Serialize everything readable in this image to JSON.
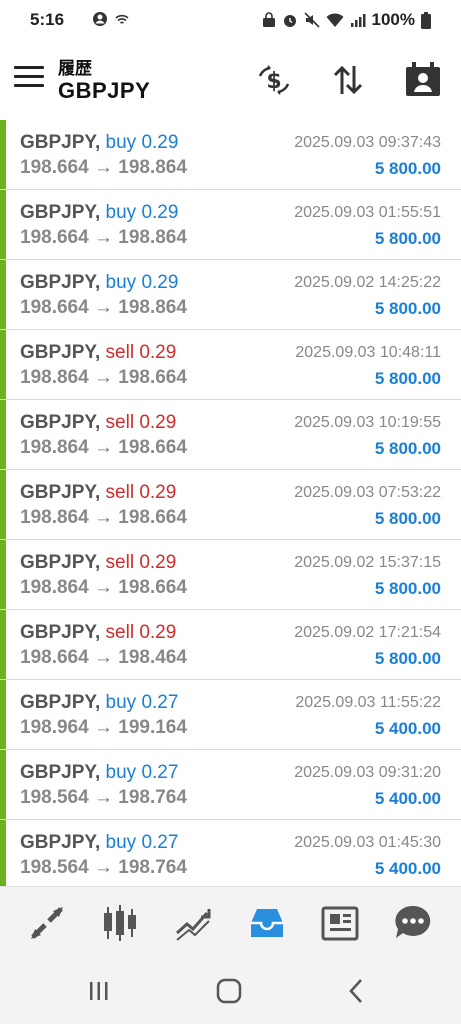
{
  "status": {
    "time": "5:16",
    "battery": "100%"
  },
  "header": {
    "subtitle": "履歴",
    "title": "GBPJPY"
  },
  "trades": [
    {
      "symbol": "GBPJPY,",
      "side": "buy",
      "side_label": "buy 0.29",
      "open": "198.664",
      "close": "198.864",
      "arrow": "→",
      "date": "2025.09.03 09:37:43",
      "profit": "5 800.00"
    },
    {
      "symbol": "GBPJPY,",
      "side": "buy",
      "side_label": "buy 0.29",
      "open": "198.664",
      "close": "198.864",
      "arrow": "→",
      "date": "2025.09.03 01:55:51",
      "profit": "5 800.00"
    },
    {
      "symbol": "GBPJPY,",
      "side": "buy",
      "side_label": "buy 0.29",
      "open": "198.664",
      "close": "198.864",
      "arrow": "→",
      "date": "2025.09.02 14:25:22",
      "profit": "5 800.00"
    },
    {
      "symbol": "GBPJPY,",
      "side": "sell",
      "side_label": "sell 0.29",
      "open": "198.864",
      "close": "198.664",
      "arrow": "→",
      "date": "2025.09.03 10:48:11",
      "profit": "5 800.00"
    },
    {
      "symbol": "GBPJPY,",
      "side": "sell",
      "side_label": "sell 0.29",
      "open": "198.864",
      "close": "198.664",
      "arrow": "→",
      "date": "2025.09.03 10:19:55",
      "profit": "5 800.00"
    },
    {
      "symbol": "GBPJPY,",
      "side": "sell",
      "side_label": "sell 0.29",
      "open": "198.864",
      "close": "198.664",
      "arrow": "→",
      "date": "2025.09.03 07:53:22",
      "profit": "5 800.00"
    },
    {
      "symbol": "GBPJPY,",
      "side": "sell",
      "side_label": "sell 0.29",
      "open": "198.864",
      "close": "198.664",
      "arrow": "→",
      "date": "2025.09.02 15:37:15",
      "profit": "5 800.00"
    },
    {
      "symbol": "GBPJPY,",
      "side": "sell",
      "side_label": "sell 0.29",
      "open": "198.664",
      "close": "198.464",
      "arrow": "→",
      "date": "2025.09.02 17:21:54",
      "profit": "5 800.00"
    },
    {
      "symbol": "GBPJPY,",
      "side": "buy",
      "side_label": "buy 0.27",
      "open": "198.964",
      "close": "199.164",
      "arrow": "→",
      "date": "2025.09.03 11:55:22",
      "profit": "5 400.00"
    },
    {
      "symbol": "GBPJPY,",
      "side": "buy",
      "side_label": "buy 0.27",
      "open": "198.564",
      "close": "198.764",
      "arrow": "→",
      "date": "2025.09.03 09:31:20",
      "profit": "5 400.00"
    },
    {
      "symbol": "GBPJPY,",
      "side": "buy",
      "side_label": "buy 0.27",
      "open": "198.564",
      "close": "198.764",
      "arrow": "→",
      "date": "2025.09.03 01:45:30",
      "profit": "5 400.00"
    }
  ],
  "colors": {
    "buy": "#1a7fd6",
    "sell": "#d32b2b",
    "profit": "#1a7fd6",
    "accent_bar": "#6db21e",
    "active_tab": "#2b8fe0"
  },
  "icons": {
    "header": [
      "currency-exchange-icon",
      "sort-icon",
      "calendar-contact-icon"
    ],
    "tabs": [
      "quotes-icon",
      "chart-icon",
      "trade-icon",
      "history-icon",
      "news-icon",
      "messages-icon"
    ],
    "active_tab": "history-icon"
  }
}
